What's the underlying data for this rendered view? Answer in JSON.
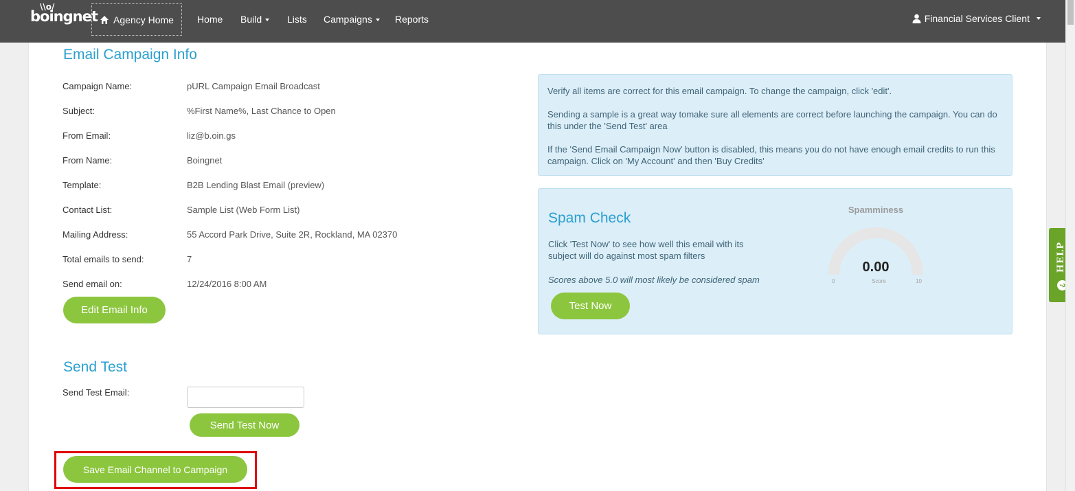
{
  "nav": {
    "logo": "boingnet",
    "agency_home": "Agency Home",
    "items": [
      {
        "label": "Home",
        "dropdown": false
      },
      {
        "label": "Build",
        "dropdown": true
      },
      {
        "label": "Lists",
        "dropdown": false
      },
      {
        "label": "Campaigns",
        "dropdown": true
      },
      {
        "label": "Reports",
        "dropdown": false
      }
    ],
    "user": "Financial Services Client"
  },
  "campaign_info": {
    "title": "Email Campaign Info",
    "rows": [
      {
        "label": "Campaign Name:",
        "value": "pURL Campaign Email Broadcast"
      },
      {
        "label": "Subject:",
        "value": "%First Name%, Last Chance to Open"
      },
      {
        "label": "From Email:",
        "value": "liz@b.oin.gs"
      },
      {
        "label": "From Name:",
        "value": "Boingnet"
      },
      {
        "label": "Template:",
        "value": "B2B Lending Blast Email (preview)"
      },
      {
        "label": "Contact List:",
        "value": "Sample List (Web Form List)"
      },
      {
        "label": "Mailing Address:",
        "value": "55 Accord Park Drive, Suite 2R, Rockland, MA 02370"
      },
      {
        "label": "Total emails to send:",
        "value": "7"
      },
      {
        "label": "Send email on:",
        "value": "12/24/2016 8:00 AM"
      }
    ],
    "edit_button": "Edit Email Info"
  },
  "notice": {
    "paragraphs": [
      "Verify all items are correct for this email campaign. To change the campaign, click 'edit'.",
      "Sending a sample is a great way tomake sure all elements are correct before launching the campaign. You can do this under the 'Send Test' area",
      "If the 'Send Email Campaign Now' button is disabled, this means you do not have enough email credits to run this campaign. Click on 'My Account' and then 'Buy Credits'"
    ]
  },
  "spam_check": {
    "title": "Spam Check",
    "description": "Click 'Test Now' to see how well this email with its subject will do against most spam filters",
    "note": "Scores above 5.0 will most likely be considered spam",
    "button": "Test Now",
    "gauge": {
      "title": "Spamminess",
      "value": "0.00",
      "value_label": "Score",
      "min": "0",
      "max": "10"
    }
  },
  "send_test": {
    "title": "Send Test",
    "label": "Send Test Email:",
    "input_value": "",
    "button": "Send Test Now"
  },
  "save_button": "Save Email Channel to Campaign",
  "help_tab": {
    "label": "HELP",
    "icon": "?"
  },
  "colors": {
    "nav_bg": "#4d4d4d",
    "accent_blue": "#2a9fd0",
    "button_green": "#8cc63e",
    "help_green": "#6aa428",
    "info_bg": "#dceef8",
    "highlight_red": "#e00000"
  }
}
